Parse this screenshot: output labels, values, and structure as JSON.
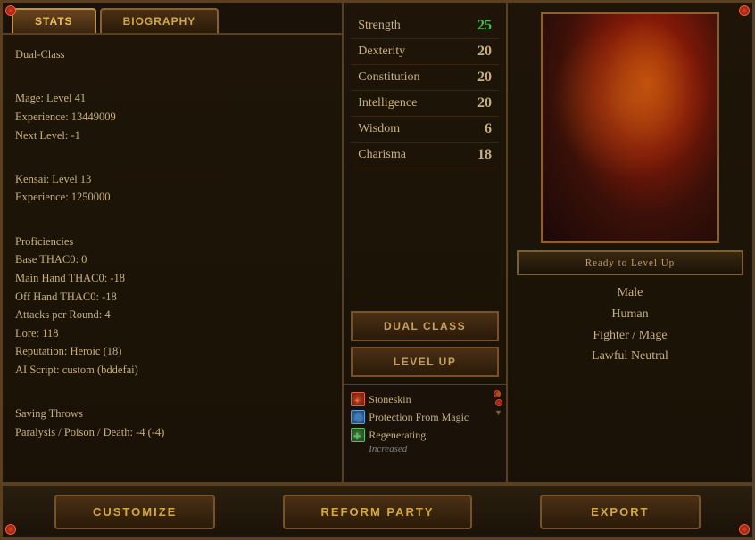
{
  "tabs": {
    "stats": {
      "label": "STATS",
      "active": true
    },
    "biography": {
      "label": "BIOGRAPHY",
      "active": false
    }
  },
  "stats": {
    "class_line": "Dual-Class",
    "mage_line": "Mage: Level 41",
    "experience_line": "Experience: 13449009",
    "next_level_line": "Next Level: -1",
    "kensai_line": "Kensai: Level 13",
    "kensai_exp_line": "Experience: 1250000",
    "proficiencies_title": "Proficiencies",
    "base_thac0": "Base THAC0: 0",
    "main_hand_thac0": "Main Hand THAC0: -18",
    "off_hand_thac0": "Off Hand THAC0: -18",
    "attacks_per_round": "Attacks per Round: 4",
    "lore": "Lore: 118",
    "reputation": "Reputation: Heroic (18)",
    "ai_script": "AI Script: custom (bddefai)",
    "saving_throws_title": "Saving Throws",
    "saving_throws_line": "Paralysis / Poison / Death: -4 (-4)"
  },
  "attributes": [
    {
      "name": "Strength",
      "value": "25",
      "green": true
    },
    {
      "name": "Dexterity",
      "value": "20",
      "green": false
    },
    {
      "name": "Constitution",
      "value": "20",
      "green": false
    },
    {
      "name": "Intelligence",
      "value": "20",
      "green": false
    },
    {
      "name": "Wisdom",
      "value": "6",
      "green": false
    },
    {
      "name": "Charisma",
      "value": "18",
      "green": false
    }
  ],
  "buttons": {
    "dual_class": "DUAL CLASS",
    "level_up": "LEVEL UP"
  },
  "active_effects": [
    {
      "name": "Stoneskin",
      "icon_type": "red-cross"
    },
    {
      "name": "Protection From Magic",
      "icon_type": "blue"
    },
    {
      "name": "Regenerating",
      "icon_type": "blue-cross"
    },
    {
      "name": "Increased",
      "style": "muted"
    }
  ],
  "character": {
    "level_up_badge": "Ready to Level Up",
    "gender": "Male",
    "race": "Human",
    "class": "Fighter / Mage",
    "alignment": "Lawful Neutral"
  },
  "bottom_buttons": {
    "customize": "CUSTOMIZE",
    "reform_party": "REFORM PARTY",
    "export": "EXPORT"
  }
}
